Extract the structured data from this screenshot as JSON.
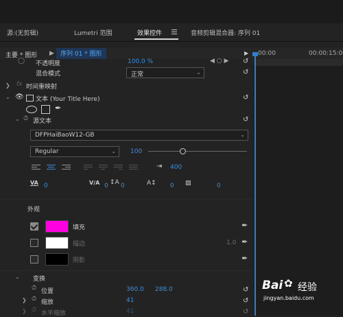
{
  "tabs": [
    {
      "label": "源:(无剪辑)",
      "active": false
    },
    {
      "label": "Lumetri 范围",
      "active": false
    },
    {
      "label": "效果控件",
      "active": true
    },
    {
      "label": "音频剪辑混合器: 序列 01",
      "active": false
    }
  ],
  "tab_menu_icon": "hamburger-menu-icon",
  "header": {
    "master": "主要 * 图形",
    "sequence": "序列 01 * 图形",
    "time_start": "00:00",
    "time_end": "00:00:15:00"
  },
  "rows": {
    "opacity_label": "不透明度",
    "opacity_value": "100.0 %",
    "blend_label": "混合模式",
    "blend_value": "正常",
    "time_remap": "时间重映射",
    "text_layer": "文本 (Your Title Here)",
    "source_text": "源文本"
  },
  "text": {
    "font": "DFPHaiBaoW12-GB",
    "style": "Regular",
    "size": "100",
    "size_slider_fraction": 0.35,
    "tracking_value": "400",
    "kerning": "0",
    "tracking": "0",
    "baseline": "0",
    "leading": "0",
    "tsume": "0"
  },
  "appearance": {
    "section": "外观",
    "fill": {
      "label": "填充",
      "color": "#ff00e0",
      "checked": true
    },
    "stroke": {
      "label": "描边",
      "color": "#ffffff",
      "checked": false,
      "width": "1.0"
    },
    "shadow": {
      "label": "阴影",
      "color": "#000000",
      "checked": false
    }
  },
  "transform": {
    "section": "变换",
    "position_label": "位置",
    "position_x": "360.0",
    "position_y": "288.0",
    "scale_label": "缩放",
    "scale_value": "41",
    "hscale_label": "水平缩放",
    "hscale_value": "41"
  },
  "watermark": {
    "brand": "Bai",
    "brand_suffix": "经验",
    "url": "jingyan.baidu.com"
  },
  "colors": {
    "accent": "#3b8fe0",
    "playhead": "#2f7fd8"
  }
}
